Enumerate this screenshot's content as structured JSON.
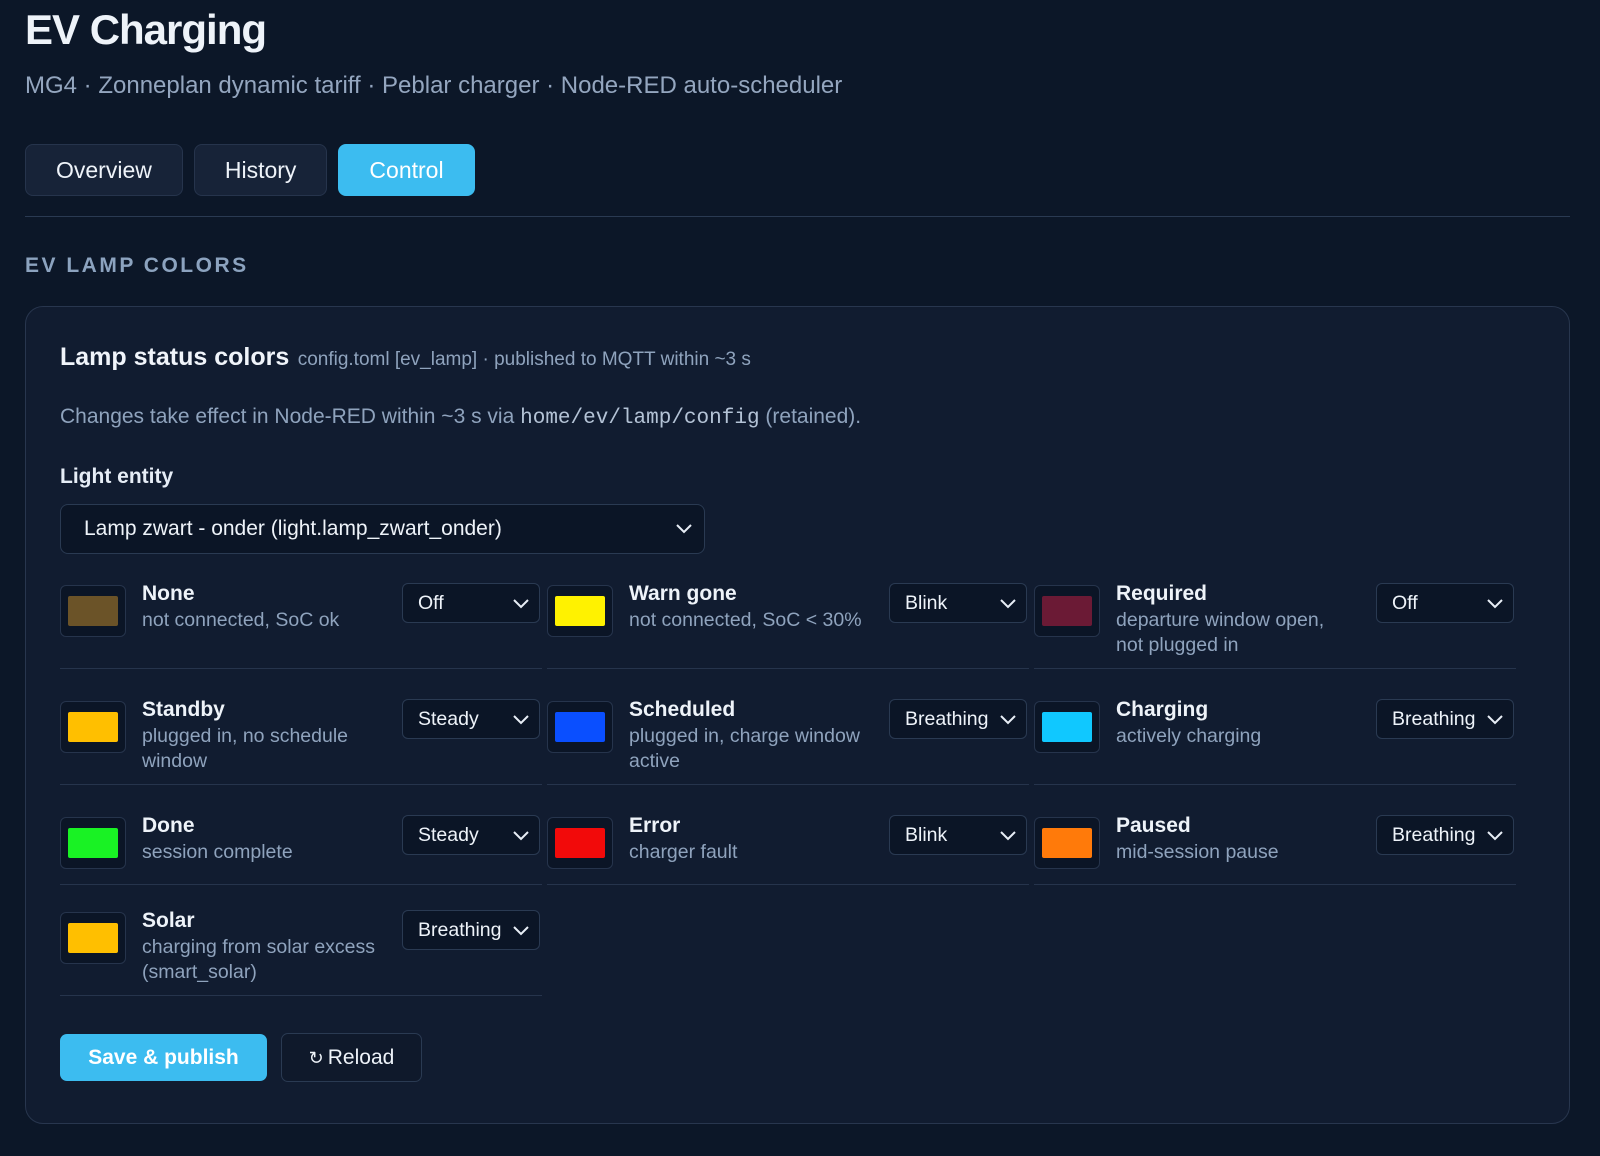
{
  "header": {
    "title": "EV Charging",
    "subtitle": "MG4 · Zonneplan dynamic tariff · Peblar charger · Node-RED auto-scheduler"
  },
  "tabs": [
    {
      "label": "Overview",
      "active": false
    },
    {
      "label": "History",
      "active": false
    },
    {
      "label": "Control",
      "active": true
    }
  ],
  "section": {
    "title": "EV LAMP COLORS"
  },
  "card": {
    "title": "Lamp status colors",
    "meta": "config.toml [ev_lamp] · published to MQTT within ~3 s",
    "note_prefix": "Changes take effect in Node-RED within ~3 s via ",
    "note_code": "home/ev/lamp/config",
    "note_suffix": " (retained).",
    "entity_label": "Light entity",
    "entity_value": "Lamp zwart - onder (light.lamp_zwart_onder)"
  },
  "statuses": [
    {
      "name": "None",
      "desc": "not connected, SoC ok",
      "mode": "Off",
      "color": "#6b5328"
    },
    {
      "name": "Warn gone",
      "desc": "not connected, SoC < 30%",
      "mode": "Blink",
      "color": "#fff200"
    },
    {
      "name": "Required",
      "desc": "departure window open, not plugged in",
      "mode": "Off",
      "color": "#6b1a35"
    },
    {
      "name": "Standby",
      "desc": "plugged in, no schedule window",
      "mode": "Steady",
      "color": "#ffbf00"
    },
    {
      "name": "Scheduled",
      "desc": "plugged in, charge window active",
      "mode": "Breathing",
      "color": "#0a4fff"
    },
    {
      "name": "Charging",
      "desc": "actively charging",
      "mode": "Breathing",
      "color": "#10c8ff"
    },
    {
      "name": "Done",
      "desc": "session complete",
      "mode": "Steady",
      "color": "#19f224"
    },
    {
      "name": "Error",
      "desc": "charger fault",
      "mode": "Blink",
      "color": "#f20a0a"
    },
    {
      "name": "Paused",
      "desc": "mid-session pause",
      "mode": "Breathing",
      "color": "#ff7a0a"
    },
    {
      "name": "Solar",
      "desc": "charging from solar excess (smart_solar)",
      "mode": "Breathing",
      "color": "#ffbf00"
    }
  ],
  "actions": {
    "save_label": "Save & publish",
    "reload_icon": "↻",
    "reload_label": "Reload"
  }
}
